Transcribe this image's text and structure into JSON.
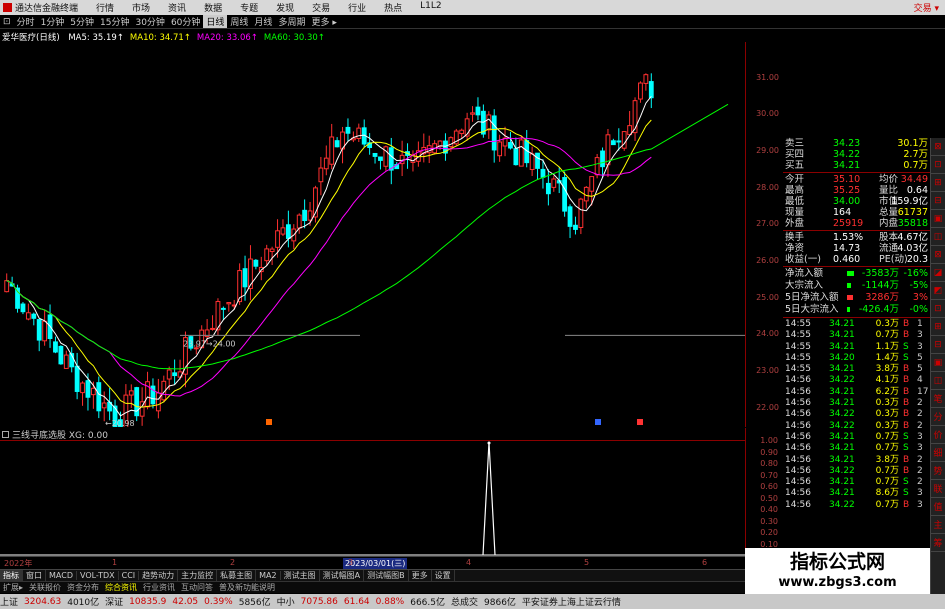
{
  "menubar": {
    "app_name": "通达信金融终端",
    "items": [
      "行情",
      "市场",
      "资讯",
      "数据",
      "专题",
      "发现",
      "交易",
      "行业",
      "热点",
      "L1L2"
    ],
    "right_label": "交易 ▾"
  },
  "period_bar": {
    "items": [
      "⊡",
      "分时",
      "1分钟",
      "5分钟",
      "15分钟",
      "30分钟",
      "60分钟",
      "日线",
      "周线",
      "月线",
      "多周期",
      "更多 ▸"
    ],
    "selected": "日线"
  },
  "ma_legend": {
    "stock_name": "爱华医疗(日线)",
    "items": [
      {
        "label": "MA5: 35.19↑",
        "color": "#ffffff"
      },
      {
        "label": "MA10: 34.71↑",
        "color": "#ffff00"
      },
      {
        "label": "MA20: 33.06↑",
        "color": "#ff00ff"
      },
      {
        "label": "MA60: 30.30↑",
        "color": "#00ff00"
      }
    ]
  },
  "main_chart": {
    "price_range": [
      21.5,
      32
    ],
    "ticks": [
      "31.00",
      "30.00",
      "29.00",
      "28.00",
      "27.00",
      "26.00",
      "25.00",
      "24.00",
      "23.00",
      "22.00"
    ],
    "tick_values": [
      31,
      30,
      29,
      28,
      27,
      26,
      25,
      24,
      23,
      22
    ],
    "annotations": [
      {
        "text": "23.97→24.00",
        "x": "0",
        "y": 24.0
      },
      {
        "text": "←20.98",
        "x": "0",
        "y": 22.0
      }
    ],
    "colors": {
      "up": "#ff3030",
      "down": "#00ffff",
      "ma5": "#ffffff",
      "ma10": "#ffff00",
      "ma20": "#ff00ff",
      "ma60": "#00ff00"
    }
  },
  "sub_indicator": {
    "title": "三线寻底选股 XG: 0.00",
    "ticks": [
      "1.00",
      "0.90",
      "0.80",
      "0.70",
      "0.60",
      "0.50",
      "0.40",
      "0.30",
      "0.20",
      "0.10"
    ]
  },
  "datebar": {
    "left": "2022年",
    "selected": "2023/03/01(三)",
    "marks": [
      "1",
      "2",
      "3",
      "4",
      "5",
      "6"
    ]
  },
  "tabs": [
    "指标",
    "窗口",
    "MACD",
    "VOL-TDX",
    "CCI",
    "趋势动力",
    "主力监控",
    "私募主图",
    "MA2",
    "测试主图",
    "测试幅图A",
    "测试幅图B",
    "更多",
    "设置"
  ],
  "tabs2": [
    "扩展▸",
    "关联报价",
    "资金分布",
    "综合资讯",
    "行业资讯",
    "互动问答",
    "普及新功能说明"
  ],
  "tabs2_selected": "综合资讯",
  "quote": {
    "asks": [
      {
        "label": "卖三",
        "price": "34.23",
        "vol": "30.1万"
      },
      {
        "label": "买四",
        "price": "34.22",
        "vol": "2.7万"
      },
      {
        "label": "买五",
        "price": "34.21",
        "vol": "0.7万"
      }
    ],
    "stats": [
      {
        "l1": "今开",
        "v1": "35.10",
        "c1": "#ff3030",
        "l2": "均价",
        "v2": "34.49",
        "c2": "#ff3030"
      },
      {
        "l1": "最高",
        "v1": "35.25",
        "c1": "#ff3030",
        "l2": "量比",
        "v2": "0.64",
        "c2": "#ffffff"
      },
      {
        "l1": "最低",
        "v1": "34.00",
        "c1": "#00ff00",
        "l2": "市值",
        "v2": "159.9亿",
        "c2": "#ffffff"
      },
      {
        "l1": "现量",
        "v1": "164",
        "c1": "#ffffff",
        "l2": "总量",
        "v2": "61737",
        "c2": "#ffff00"
      },
      {
        "l1": "外盘",
        "v1": "25919",
        "c1": "#ff3030",
        "l2": "内盘",
        "v2": "35818",
        "c2": "#00ff00"
      }
    ],
    "stats2": [
      {
        "l1": "换手",
        "v1": "1.53%",
        "c1": "#ffffff",
        "l2": "股本",
        "v2": "4.67亿",
        "c2": "#ffffff"
      },
      {
        "l1": "净资",
        "v1": "14.73",
        "c1": "#ffffff",
        "l2": "流通",
        "v2": "4.03亿",
        "c2": "#ffffff"
      },
      {
        "l1": "收益(一)",
        "v1": "0.460",
        "c1": "#ffffff",
        "l2": "PE(动)",
        "v2": "20.3",
        "c2": "#ffffff"
      }
    ],
    "flows": [
      {
        "label": "净流入额",
        "value": "-3583万",
        "pct": "-16%",
        "bar_fraction": 0.9,
        "color": "#00ff00"
      },
      {
        "label": "大宗流入",
        "value": "-1144万",
        "pct": "-5%",
        "bar_fraction": 0.3,
        "color": "#00ff00"
      },
      {
        "label": "5日净流入额",
        "value": "3286万",
        "pct": "3%",
        "bar_fraction": 0.6,
        "color": "#ff3030"
      },
      {
        "label": "5日大宗流入",
        "value": "-426.4万",
        "pct": "-0%",
        "bar_fraction": 0.1,
        "color": "#00ff00"
      }
    ],
    "ticks": [
      {
        "t": "14:55",
        "p": "34.21",
        "v": "0.3万",
        "s": "B",
        "n": "1"
      },
      {
        "t": "14:55",
        "p": "34.21",
        "v": "0.7万",
        "s": "B",
        "n": "3"
      },
      {
        "t": "14:55",
        "p": "34.21",
        "v": "1.1万",
        "s": "S",
        "n": "3"
      },
      {
        "t": "14:55",
        "p": "34.20",
        "v": "1.4万",
        "s": "S",
        "n": "5"
      },
      {
        "t": "14:55",
        "p": "34.21",
        "v": "3.8万",
        "s": "B",
        "n": "5"
      },
      {
        "t": "14:56",
        "p": "34.22",
        "v": "4.1万",
        "s": "B",
        "n": "4"
      },
      {
        "t": "14:56",
        "p": "34.21",
        "v": "6.2万",
        "s": "B",
        "n": "17"
      },
      {
        "t": "14:56",
        "p": "34.21",
        "v": "0.3万",
        "s": "B",
        "n": "2"
      },
      {
        "t": "14:56",
        "p": "34.22",
        "v": "0.3万",
        "s": "B",
        "n": "2"
      },
      {
        "t": "14:56",
        "p": "34.22",
        "v": "0.3万",
        "s": "B",
        "n": "2"
      },
      {
        "t": "14:56",
        "p": "34.21",
        "v": "0.7万",
        "s": "S",
        "n": "3"
      },
      {
        "t": "14:56",
        "p": "34.21",
        "v": "0.7万",
        "s": "S",
        "n": "3"
      },
      {
        "t": "14:56",
        "p": "34.21",
        "v": "3.8万",
        "s": "B",
        "n": "2"
      },
      {
        "t": "14:56",
        "p": "34.22",
        "v": "0.7万",
        "s": "B",
        "n": "2"
      },
      {
        "t": "14:56",
        "p": "34.21",
        "v": "0.7万",
        "s": "S",
        "n": "2"
      },
      {
        "t": "14:56",
        "p": "34.21",
        "v": "8.6万",
        "s": "S",
        "n": "3"
      },
      {
        "t": "14:56",
        "p": "34.22",
        "v": "0.7万",
        "s": "B",
        "n": "3"
      }
    ]
  },
  "side_tabs": [
    "⊠",
    "⊡",
    "⊞",
    "⊟",
    "▣",
    "◫",
    "⊠",
    "◪",
    "◩",
    "⊡",
    "⊞",
    "⊟",
    "▣",
    "◫",
    "笔",
    "分",
    "价",
    "细",
    "势",
    "联",
    "值",
    "主",
    "筹"
  ],
  "watermark": {
    "line1": "指标公式网",
    "line2": "www.zbgs3.com"
  },
  "statusbar": [
    {
      "text": "上证",
      "color": "#111111"
    },
    {
      "text": "3204.63",
      "color": "#cc0000"
    },
    {
      "text": "4010亿",
      "color": "#111111"
    },
    {
      "text": "深证",
      "color": "#111111"
    },
    {
      "text": "10835.9",
      "color": "#cc0000"
    },
    {
      "text": "42.05",
      "color": "#cc0000"
    },
    {
      "text": "0.39%",
      "color": "#cc0000"
    },
    {
      "text": "5856亿",
      "color": "#111111"
    },
    {
      "text": "中小",
      "color": "#111111"
    },
    {
      "text": "7075.86",
      "color": "#cc0000"
    },
    {
      "text": "61.64",
      "color": "#cc0000"
    },
    {
      "text": "0.88%",
      "color": "#cc0000"
    },
    {
      "text": "666.5亿",
      "color": "#111111"
    },
    {
      "text": "总成交",
      "color": "#111111"
    },
    {
      "text": "9866亿",
      "color": "#111111"
    },
    {
      "text": "平安证券上海上证云行情",
      "color": "#111111"
    }
  ]
}
